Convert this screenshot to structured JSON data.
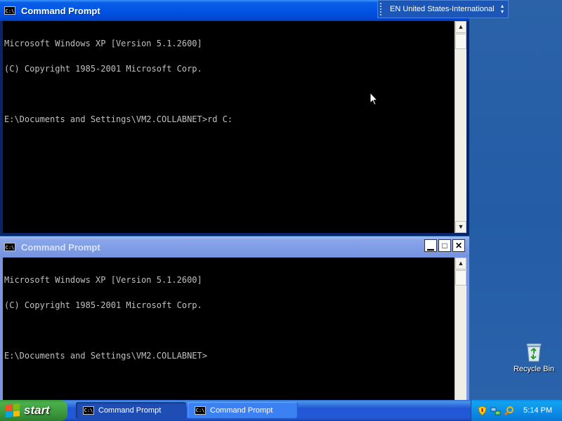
{
  "language_bar": {
    "label": "EN United States-International"
  },
  "windows": [
    {
      "title": "Command Prompt",
      "active": true,
      "console_lines": [
        "Microsoft Windows XP [Version 5.1.2600]",
        "(C) Copyright 1985-2001 Microsoft Corp.",
        "",
        "E:\\Documents and Settings\\VM2.COLLABNET>rd C:"
      ]
    },
    {
      "title": "Command Prompt",
      "active": false,
      "console_lines": [
        "Microsoft Windows XP [Version 5.1.2600]",
        "(C) Copyright 1985-2001 Microsoft Corp.",
        "",
        "E:\\Documents and Settings\\VM2.COLLABNET>"
      ]
    }
  ],
  "desktop_icons": [
    {
      "label": "Recycle Bin",
      "icon": "recycle-bin-icon"
    }
  ],
  "taskbar": {
    "start_label": "start",
    "buttons": [
      {
        "label": "Command Prompt",
        "pressed": true
      },
      {
        "label": "Command Prompt",
        "pressed": false
      }
    ],
    "clock": "5:14 PM"
  },
  "colors": {
    "console_bg": "#000000",
    "console_text": "#c0c0c0",
    "active_title": "#0055e5",
    "inactive_title": "#7e9be6",
    "desktop": "#245da6"
  }
}
